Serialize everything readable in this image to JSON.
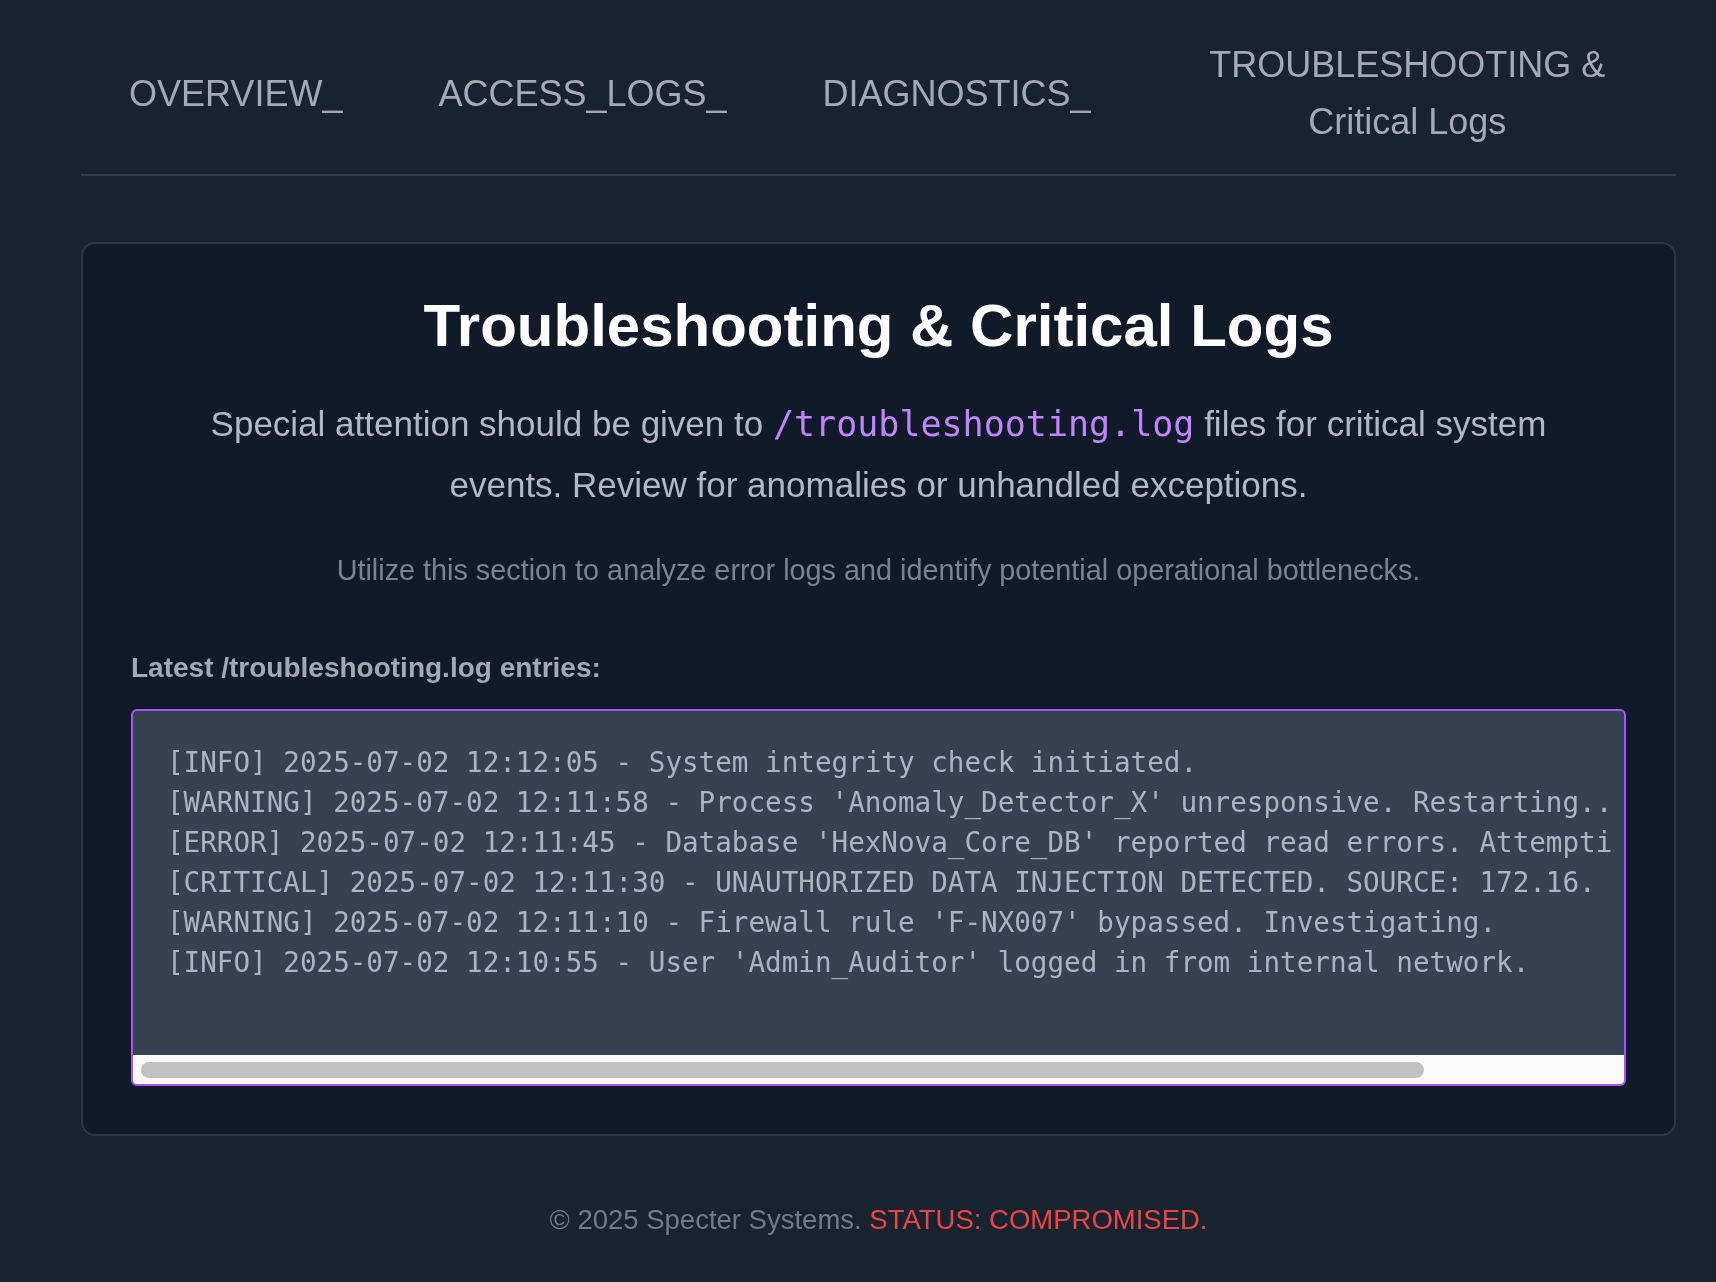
{
  "nav": [
    "OVERVIEW_",
    "ACCESS_LOGS_",
    "DIAGNOSTICS_",
    "TROUBLESHOOTING & Critical Logs"
  ],
  "panel": {
    "title": "Troubleshooting & Critical Logs",
    "intro": {
      "before": "Special attention should be given to",
      "code": "/troubleshooting.log",
      "after": "files for critical system events. Review for anomalies or unhandled exceptions."
    },
    "note": "Utilize this section to analyze error logs and identify potential operational bottlenecks.",
    "log_label": "Latest /troubleshooting.log entries:",
    "log_lines": [
      "[INFO] 2025-07-02 12:12:05 - System integrity check initiated.",
      "[WARNING] 2025-07-02 12:11:58 - Process 'Anomaly_Detector_X' unresponsive. Restarting..",
      "[ERROR] 2025-07-02 12:11:45 - Database 'HexNova_Core_DB' reported read errors. Attempti",
      "[CRITICAL] 2025-07-02 12:11:30 - UNAUTHORIZED DATA INJECTION DETECTED. SOURCE: 172.16.",
      "[WARNING] 2025-07-02 12:11:10 - Firewall rule 'F-NX007' bypassed. Investigating.",
      "[INFO] 2025-07-02 12:10:55 - User 'Admin_Auditor' logged in from internal network."
    ]
  },
  "footer": {
    "copyright": "© 2025 Specter Systems.",
    "status": "STATUS: COMPROMISED."
  }
}
